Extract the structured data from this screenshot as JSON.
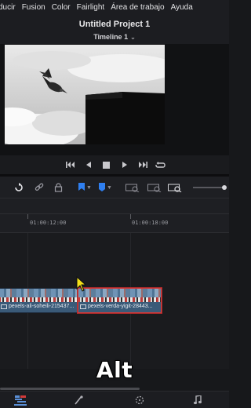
{
  "menu": [
    "ducir",
    "Fusion",
    "Color",
    "Fairlight",
    "Área de trabajo",
    "Ayuda"
  ],
  "project_title": "Untitled Project 1",
  "timeline": {
    "name": "Timeline 1"
  },
  "ruler": {
    "timecodes": [
      "01:00:12:00",
      "01:00:18:00"
    ]
  },
  "clips": [
    {
      "name": "pexels-ali-soheili-215437...",
      "selected": false
    },
    {
      "name": "pexels-verda-yigit-28443...",
      "selected": true
    }
  ],
  "caption": "Alt",
  "colors": {
    "accent": "#5a8fd6",
    "selection": "#d23a3a",
    "cursor": "#f2e019"
  },
  "icons": {
    "transport": [
      "skip-back-icon",
      "step-back-icon",
      "stop-icon",
      "play-icon",
      "skip-forward-icon",
      "loop-icon"
    ],
    "toolbar": [
      "snap-icon",
      "link-icon",
      "lock-icon",
      "flag-icon",
      "marker-icon",
      "zoom-full-icon",
      "zoom-detail-icon",
      "zoom-custom-icon",
      "zoom-slider"
    ],
    "pages": [
      "edit-page-icon",
      "fusion-page-icon",
      "color-page-icon",
      "fairlight-page-icon"
    ]
  }
}
